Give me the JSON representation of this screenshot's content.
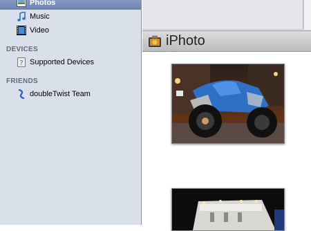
{
  "sidebar": {
    "items": [
      {
        "label": "Photos",
        "icon": "photos-icon",
        "selected": true
      },
      {
        "label": "Music",
        "icon": "music-note-icon"
      },
      {
        "label": "Video",
        "icon": "film-icon"
      }
    ],
    "devices_heading": "DEVICES",
    "devices": [
      {
        "label": "Supported Devices",
        "icon": "unknown-device-icon"
      }
    ],
    "friends_heading": "FRIENDS",
    "friends": [
      {
        "label": "doubleTwist Team",
        "icon": "doubletwist-icon"
      }
    ]
  },
  "header": {
    "title": "iPhoto",
    "icon": "iphoto-icon"
  },
  "colors": {
    "selection": "#7489b8",
    "sidebar_bg": "#d9e0e9",
    "section_heading": "#5f6a7a"
  }
}
